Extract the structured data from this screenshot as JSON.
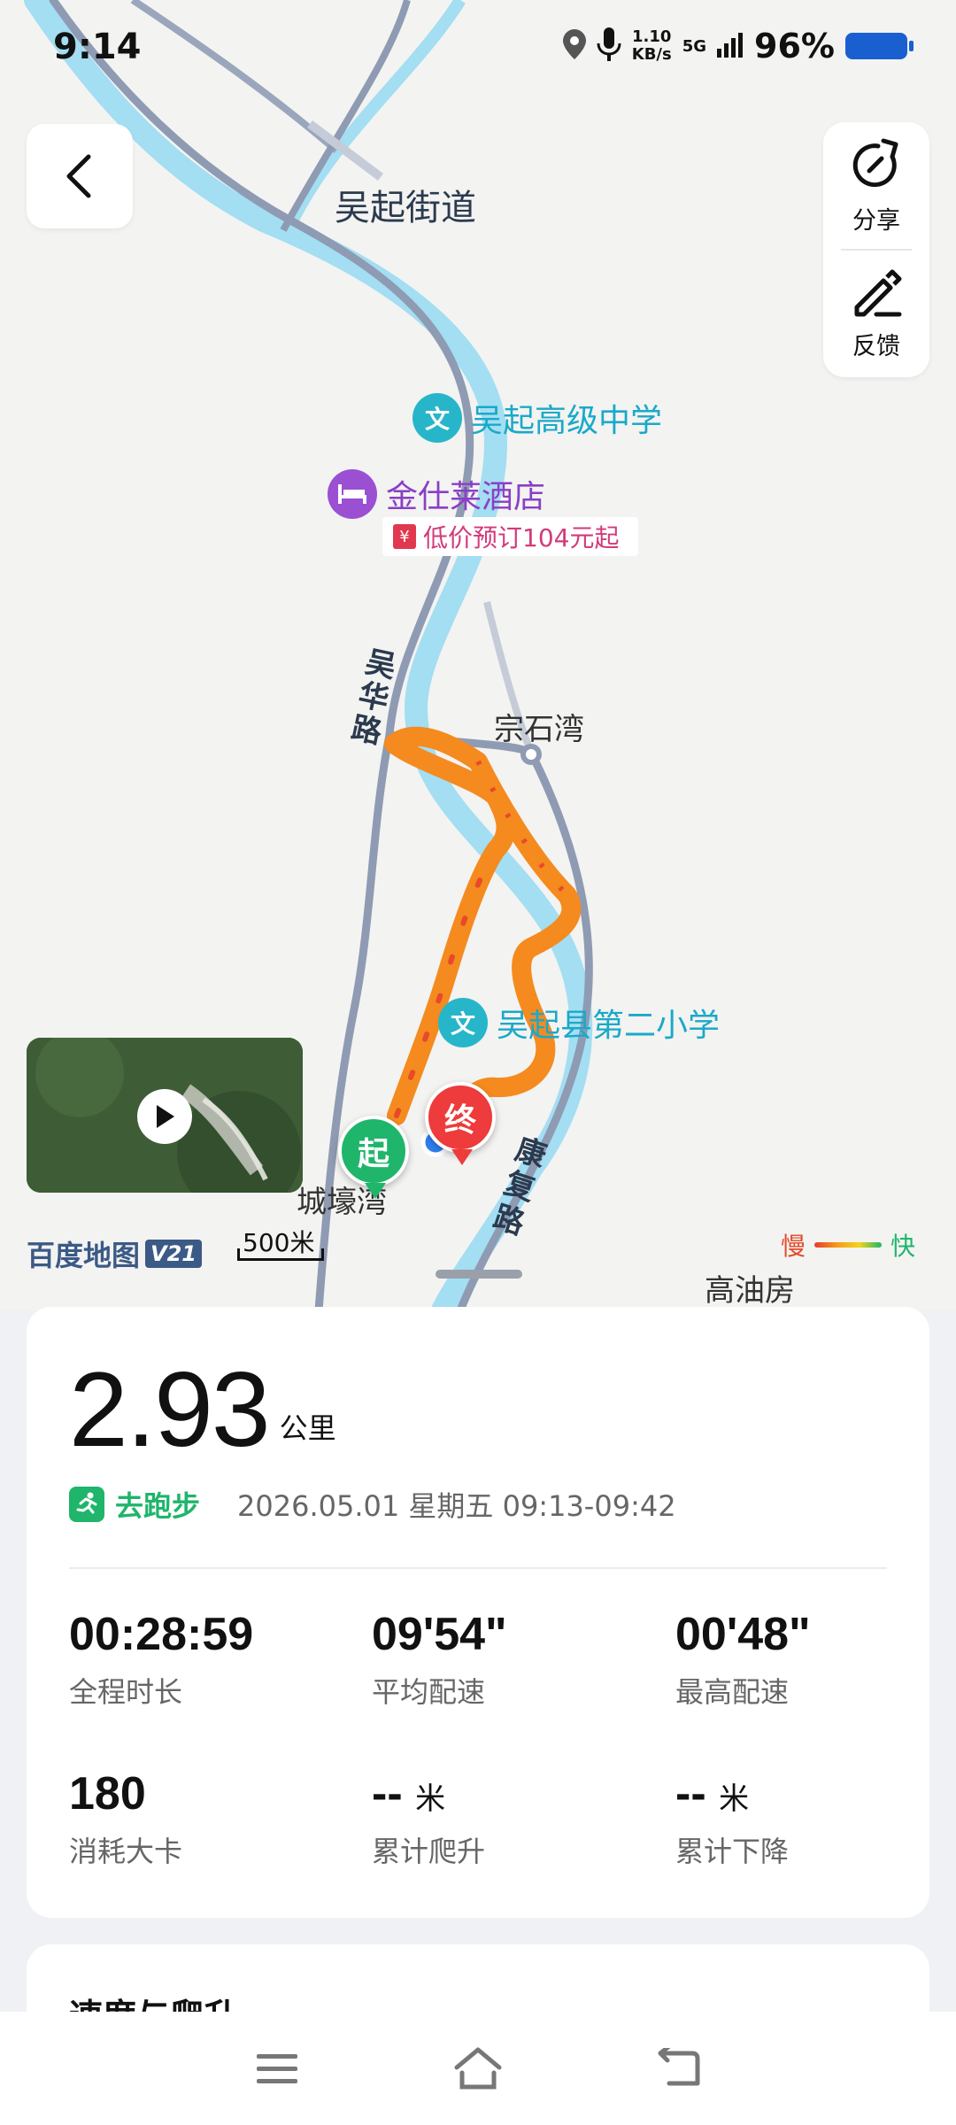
{
  "status_bar": {
    "time": "9:14",
    "net_speed_value": "1.10",
    "net_speed_unit": "KB/s",
    "network": "5G",
    "battery": "96%"
  },
  "map": {
    "street_label": "吴起街道",
    "poi_school": "吴起高级中学",
    "poi_hotel": "金仕莱酒店",
    "hotel_deal": "低价预订104元起",
    "poi_school2": "吴起县第二小学",
    "place_zongshiwan": "宗石湾",
    "place_chenghaowan": "城壕湾",
    "place_gaoyoufang": "高油房",
    "road_wuhua": "吴华路",
    "road_kangfu": "康复路",
    "marker_start": "起",
    "marker_end": "终",
    "brand": "百度地图",
    "brand_version": "V21",
    "scale": "500米",
    "legend_slow": "慢",
    "legend_fast": "快"
  },
  "side_panel": {
    "share": "分享",
    "feedback": "反馈"
  },
  "summary": {
    "distance": "2.93",
    "distance_unit": "公里",
    "activity": "去跑步",
    "datetime": "2026.05.01 星期五 09:13-09:42",
    "stats": [
      {
        "value": "00:28:59",
        "label": "全程时长"
      },
      {
        "value": "09'54\"",
        "label": "平均配速"
      },
      {
        "value": "00'48\"",
        "label": "最高配速"
      },
      {
        "value": "180",
        "label": "消耗大卡"
      },
      {
        "value": "--",
        "unit": "米",
        "label": "累计爬升"
      },
      {
        "value": "--",
        "unit": "米",
        "label": "累计下降"
      }
    ]
  },
  "section2": {
    "title": "速度与爬升"
  },
  "colors": {
    "accent_green": "#1fb56b",
    "route_orange": "#f58a1f",
    "route_red": "#e64a2a",
    "river": "#9fdcf0",
    "road": "#8e9bb3"
  }
}
